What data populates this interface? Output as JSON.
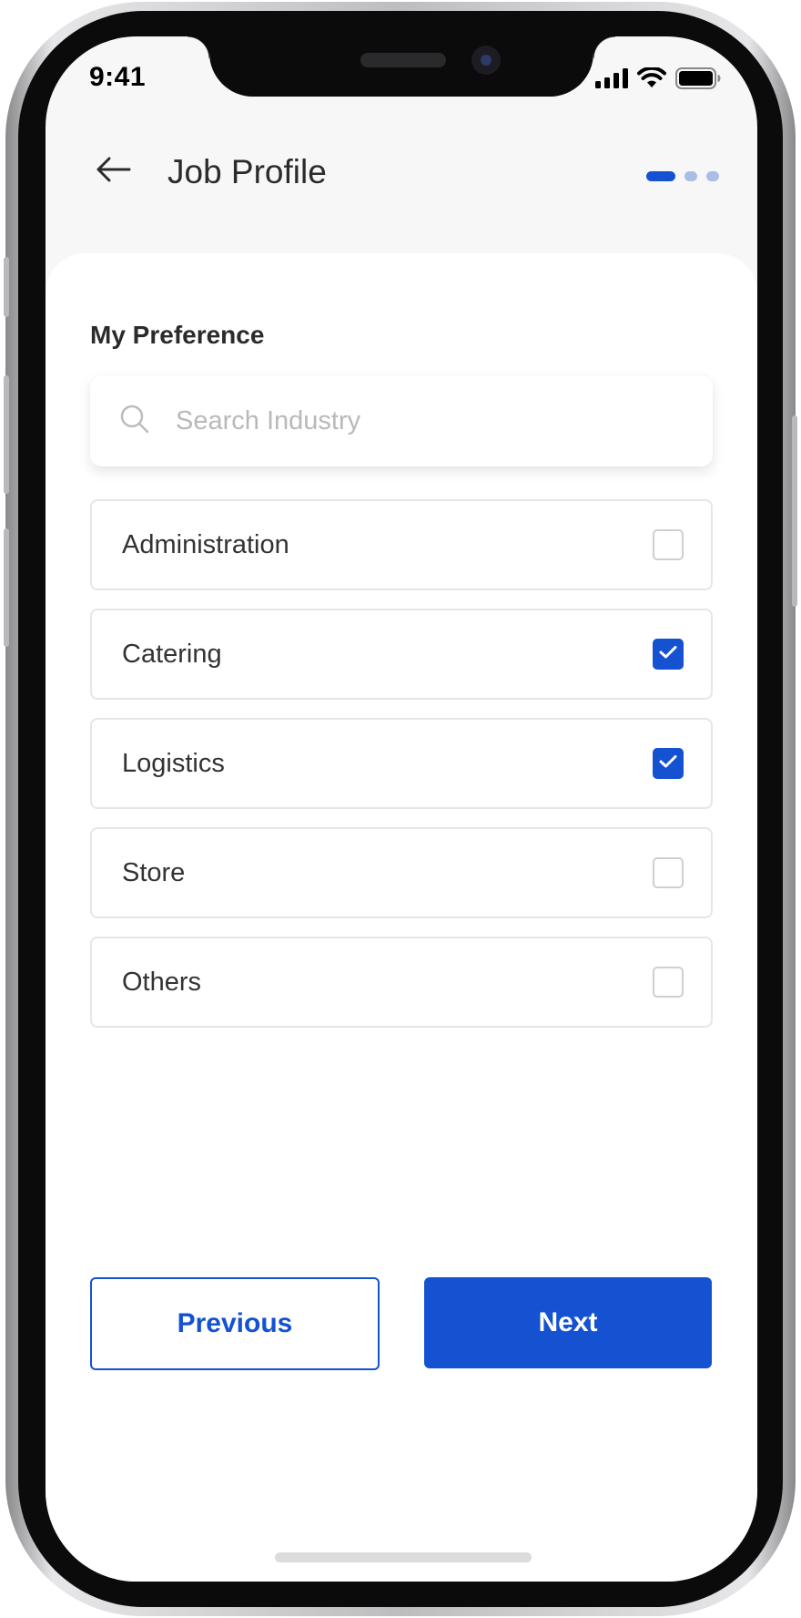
{
  "status_bar": {
    "time": "9:41",
    "icons": [
      "cellular-signal-icon",
      "wifi-icon",
      "battery-icon"
    ]
  },
  "header": {
    "title": "Job Profile",
    "back_icon": "arrow-left-icon",
    "steps": {
      "total": 3,
      "current": 1
    }
  },
  "content": {
    "section_title": "My Preference",
    "search": {
      "placeholder": "Search Industry",
      "value": "",
      "icon": "search-icon"
    },
    "industries": [
      {
        "label": "Administration",
        "checked": false
      },
      {
        "label": "Catering",
        "checked": true
      },
      {
        "label": "Logistics",
        "checked": true
      },
      {
        "label": "Store",
        "checked": false
      },
      {
        "label": "Others",
        "checked": false
      }
    ]
  },
  "footer": {
    "previous_label": "Previous",
    "next_label": "Next"
  },
  "colors": {
    "accent": "#1452d1",
    "accent_light": "#a9bde6",
    "text": "#333333",
    "border": "#e6e6e6"
  }
}
